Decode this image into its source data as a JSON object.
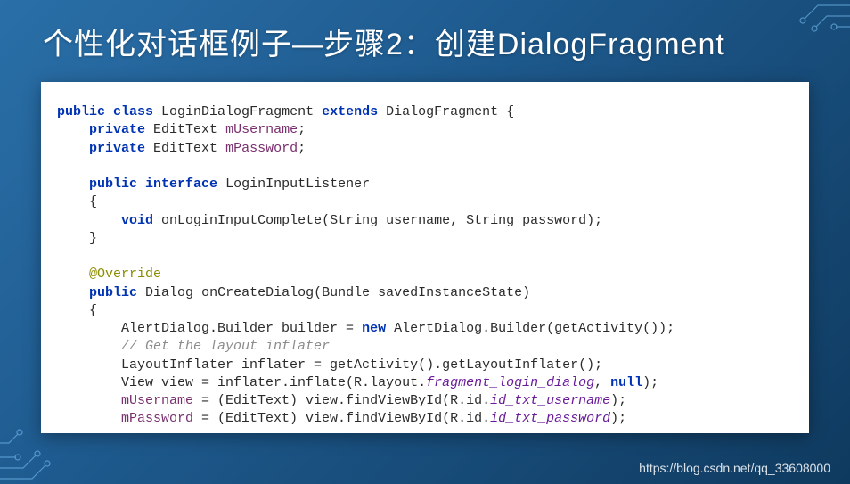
{
  "slide": {
    "title": "个性化对话框例子—步骤2：创建DialogFragment"
  },
  "code": {
    "l1_kw1": "public class",
    "l1_name": "LoginDialogFragment",
    "l1_kw2": "extends",
    "l1_sup": "DialogFragment {",
    "l2_kw": "private",
    "l2_type": "EditText",
    "l2_name": "mUsername",
    "l3_kw": "private",
    "l3_type": "EditText",
    "l3_name": "mPassword",
    "l5_kw": "public interface",
    "l5_name": "LoginInputListener",
    "l7_kw": "void",
    "l7_sig": "onLoginInputComplete(String username, String password);",
    "l10_ann": "@Override",
    "l11_kw": "public",
    "l11_type": "Dialog",
    "l11_sig": "onCreateDialog(Bundle savedInstanceState)",
    "l13a": "AlertDialog.Builder builder = ",
    "l13_kw": "new",
    "l13b": " AlertDialog.Builder(getActivity());",
    "l14_cmt": "// Get the layout inflater",
    "l15": "LayoutInflater inflater = getActivity().getLayoutInflater();",
    "l16a": "View view = inflater.inflate(R.layout.",
    "l16_lit": "fragment_login_dialog",
    "l16b": ", ",
    "l16_kw": "null",
    "l16c": ");",
    "l17a": "mUsername",
    "l17b": " = (EditText) view.findViewById(R.id.",
    "l17_lit": "id_txt_username",
    "l17c": ");",
    "l18a": "mPassword",
    "l18b": " = (EditText) view.findViewById(R.id.",
    "l18_lit": "id_txt_password",
    "l18c": ");"
  },
  "watermark": "https://blog.csdn.net/qq_33608000"
}
